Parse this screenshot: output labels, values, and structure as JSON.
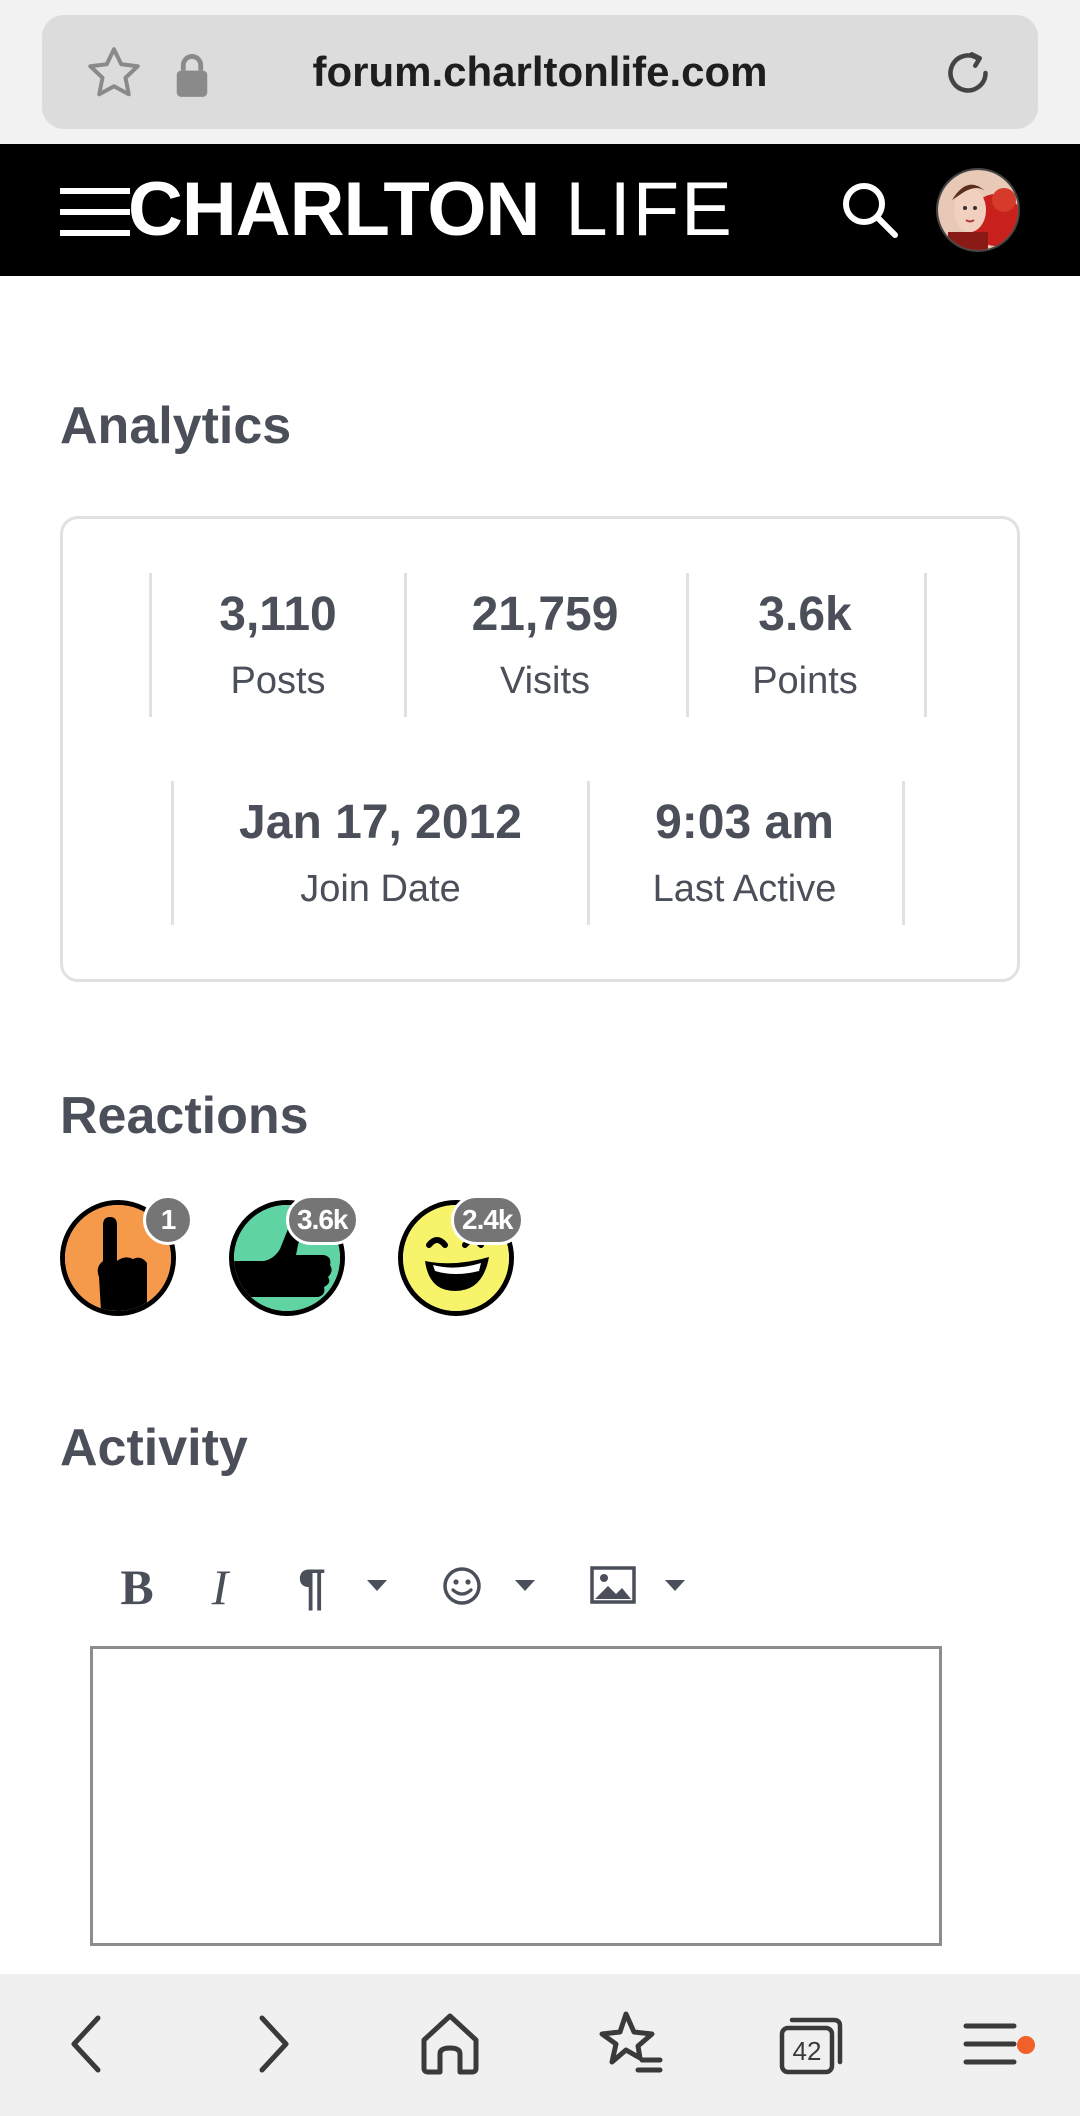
{
  "browser": {
    "url": "forum.charltonlife.com",
    "tabs_count": "42"
  },
  "site": {
    "logo_bold": "CHARLTON",
    "logo_light": "LIFE"
  },
  "analytics": {
    "title": "Analytics",
    "stats": [
      {
        "value": "3,110",
        "label": "Posts"
      },
      {
        "value": "21,759",
        "label": "Visits"
      },
      {
        "value": "3.6k",
        "label": "Points"
      },
      {
        "value": "Jan 17, 2012",
        "label": "Join Date"
      },
      {
        "value": "9:03 am",
        "label": "Last Active"
      }
    ]
  },
  "reactions": {
    "title": "Reactions",
    "items": [
      {
        "icon": "pointing-finger-icon",
        "count": "1",
        "color": "#f59a4b"
      },
      {
        "icon": "thumbs-up-icon",
        "count": "3.6k",
        "color": "#5fd3a2"
      },
      {
        "icon": "laughing-face-icon",
        "count": "2.4k",
        "color": "#f7f36a"
      }
    ]
  },
  "activity": {
    "title": "Activity",
    "toolbar": {
      "bold": "B",
      "italic": "I",
      "paragraph": "¶"
    },
    "editor_value": ""
  },
  "colors": {
    "text": "#4a4f59",
    "header_bg": "#000000",
    "badge": "#757575",
    "notification": "#f0612a"
  }
}
